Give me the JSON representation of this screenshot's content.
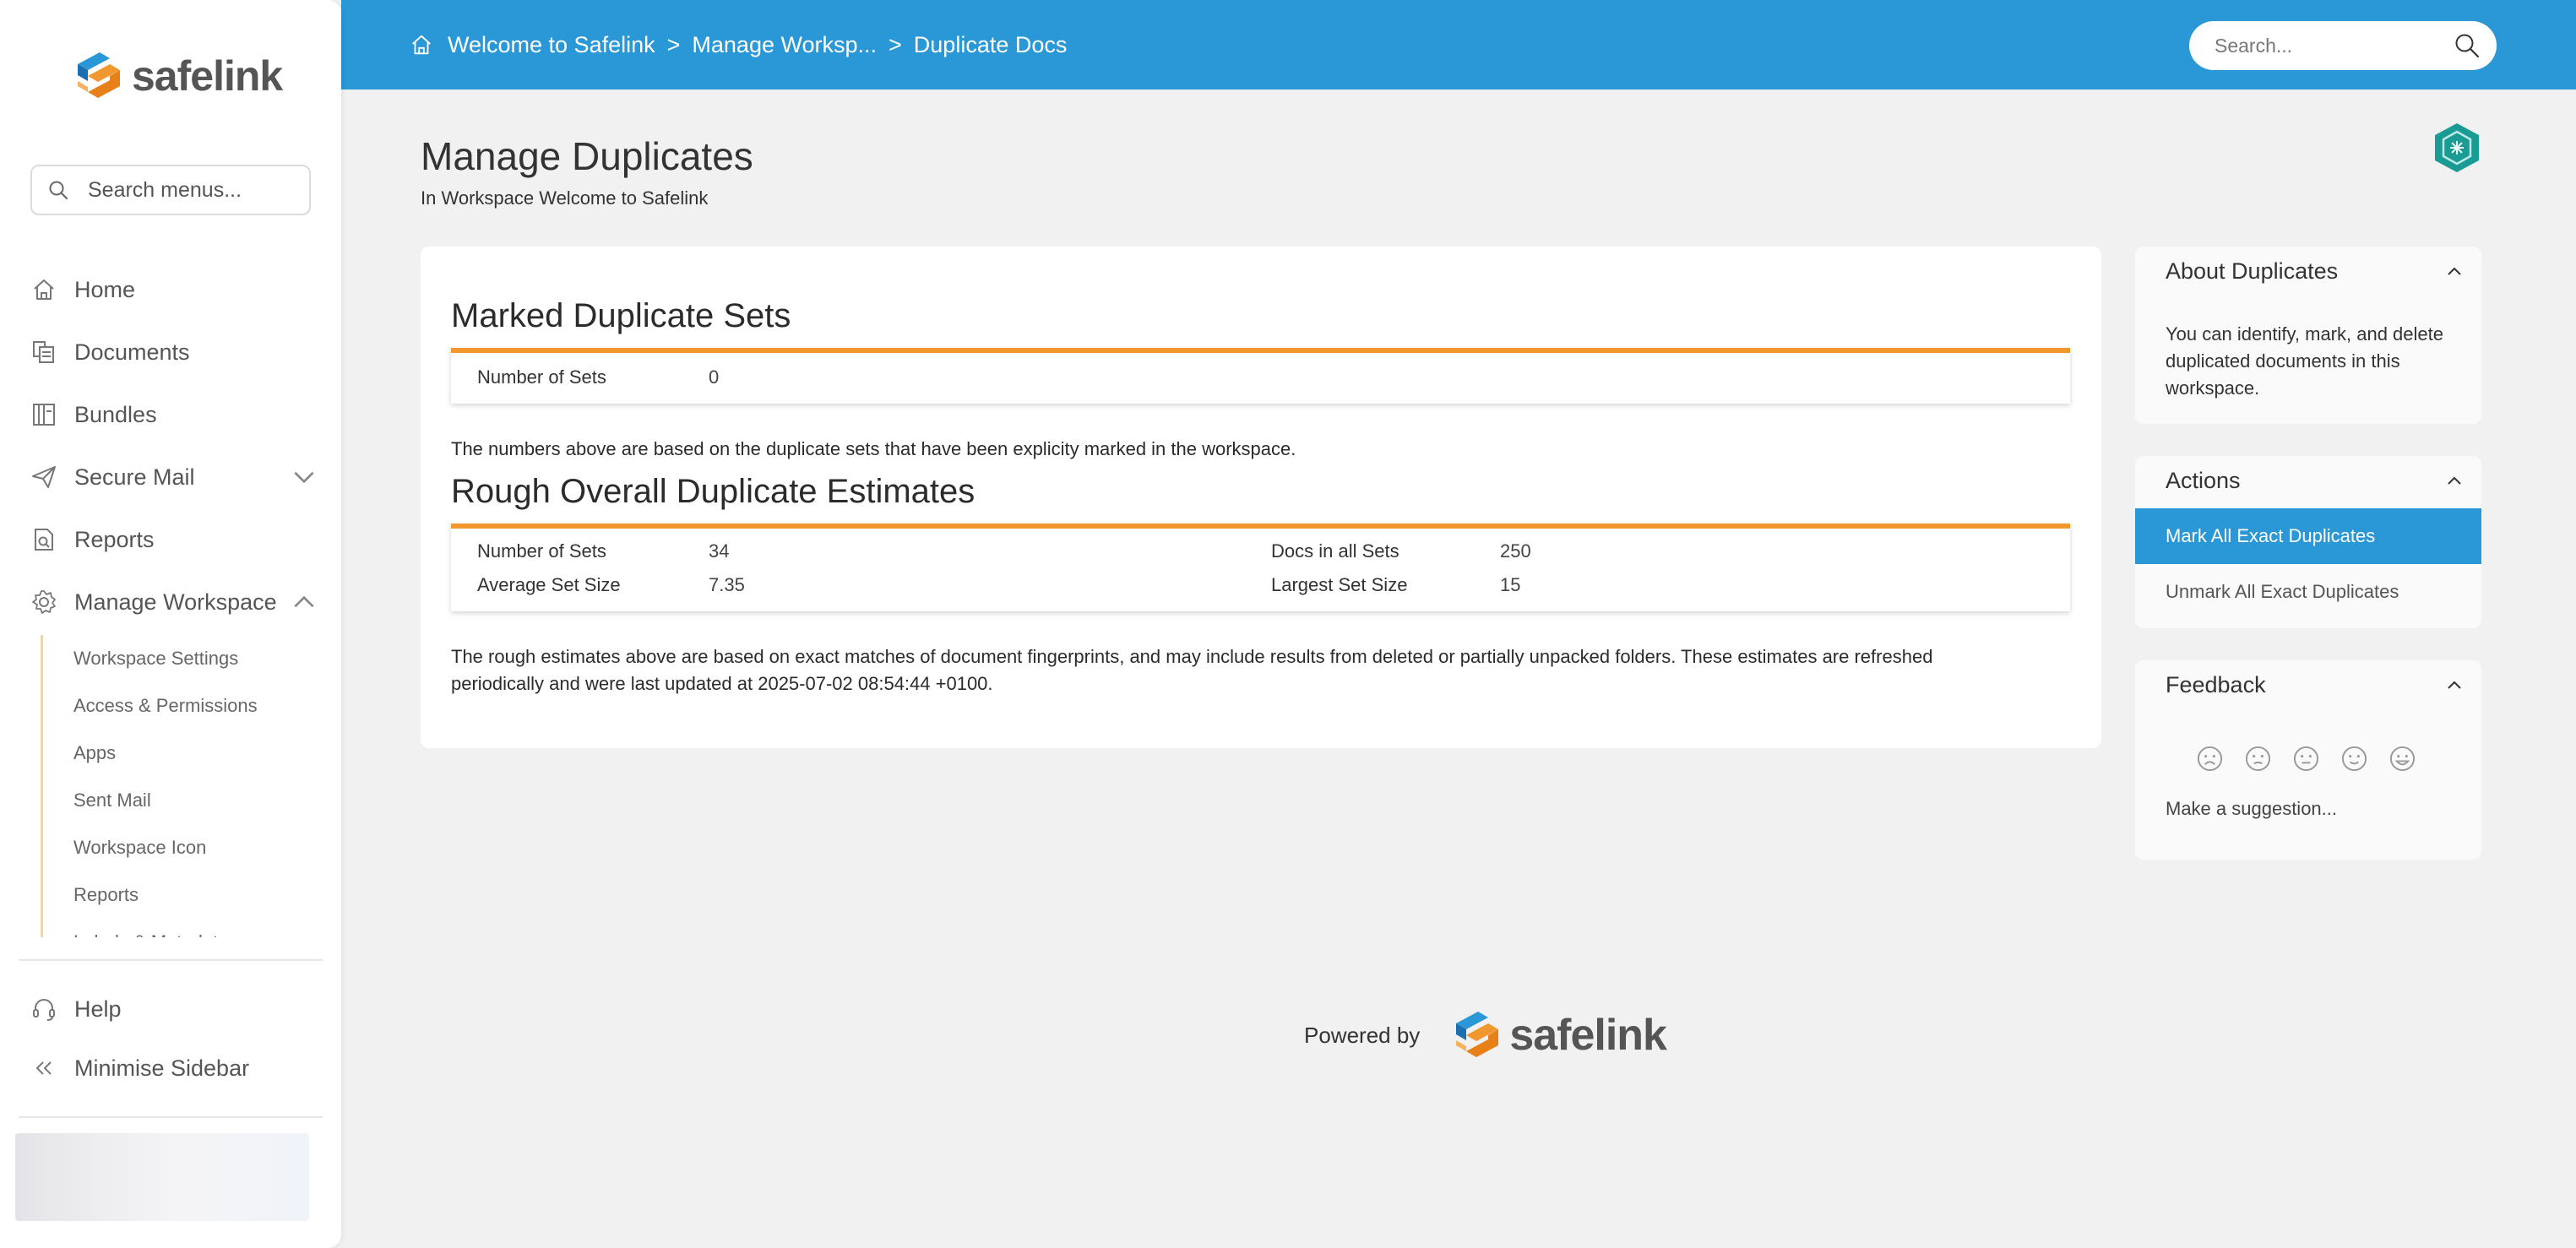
{
  "brand": {
    "name": "safelink"
  },
  "sidebar": {
    "search_placeholder": "Search menus...",
    "items": [
      {
        "label": "Home",
        "icon": "home-icon"
      },
      {
        "label": "Documents",
        "icon": "documents-icon"
      },
      {
        "label": "Bundles",
        "icon": "bundles-icon"
      },
      {
        "label": "Secure Mail",
        "icon": "send-icon"
      },
      {
        "label": "Reports",
        "icon": "reports-icon"
      },
      {
        "label": "Manage Workspace",
        "icon": "gear-icon"
      }
    ],
    "sub_items": [
      {
        "label": "Workspace Settings"
      },
      {
        "label": "Access & Permissions"
      },
      {
        "label": "Apps"
      },
      {
        "label": "Sent Mail"
      },
      {
        "label": "Workspace Icon"
      },
      {
        "label": "Reports"
      },
      {
        "label": "Labels & Metadata"
      }
    ],
    "help_label": "Help",
    "minimise_label": "Minimise Sidebar"
  },
  "header": {
    "breadcrumbs": [
      "Welcome to Safelink",
      "Manage Worksp...",
      "Duplicate Docs"
    ],
    "separator": ">",
    "search_placeholder": "Search..."
  },
  "page": {
    "title": "Manage Duplicates",
    "subtitle": "In Workspace Welcome to Safelink"
  },
  "marked": {
    "title": "Marked Duplicate Sets",
    "stats": [
      {
        "label": "Number of Sets",
        "value": "0"
      }
    ],
    "note": "The numbers above are based on the duplicate sets that have been explicity marked in the workspace."
  },
  "rough": {
    "title": "Rough Overall Duplicate Estimates",
    "stats": [
      {
        "label": "Number of Sets",
        "value": "34"
      },
      {
        "label": "Docs in all Sets",
        "value": "250"
      },
      {
        "label": "Average Set Size",
        "value": "7.35"
      },
      {
        "label": "Largest Set Size",
        "value": "15"
      }
    ],
    "note_line1": "The rough estimates above are based on exact matches of document fingerprints, and may include results from deleted or partially unpacked folders. These estimates are refreshed",
    "note_line2": "periodically and were last updated at 2025-07-02 08:54:44 +0100."
  },
  "about": {
    "title": "About Duplicates",
    "text": "You can identify, mark, and delete duplicated documents in this workspace."
  },
  "actions": {
    "title": "Actions",
    "items": [
      {
        "label": "Mark All Exact Duplicates"
      },
      {
        "label": "Unmark All Exact Duplicates"
      }
    ]
  },
  "feedback": {
    "title": "Feedback",
    "faces": [
      "very-sad-face-icon",
      "sad-face-icon",
      "neutral-face-icon",
      "happy-face-icon",
      "very-happy-face-icon"
    ],
    "suggestion": "Make a suggestion..."
  },
  "footer": {
    "powered_by": "Powered by"
  },
  "colors": {
    "header_blue": "#2a97d6",
    "accent_orange": "#f0972e",
    "action_highlight": "#2a97d6",
    "badge_teal": "#1a9b94"
  }
}
